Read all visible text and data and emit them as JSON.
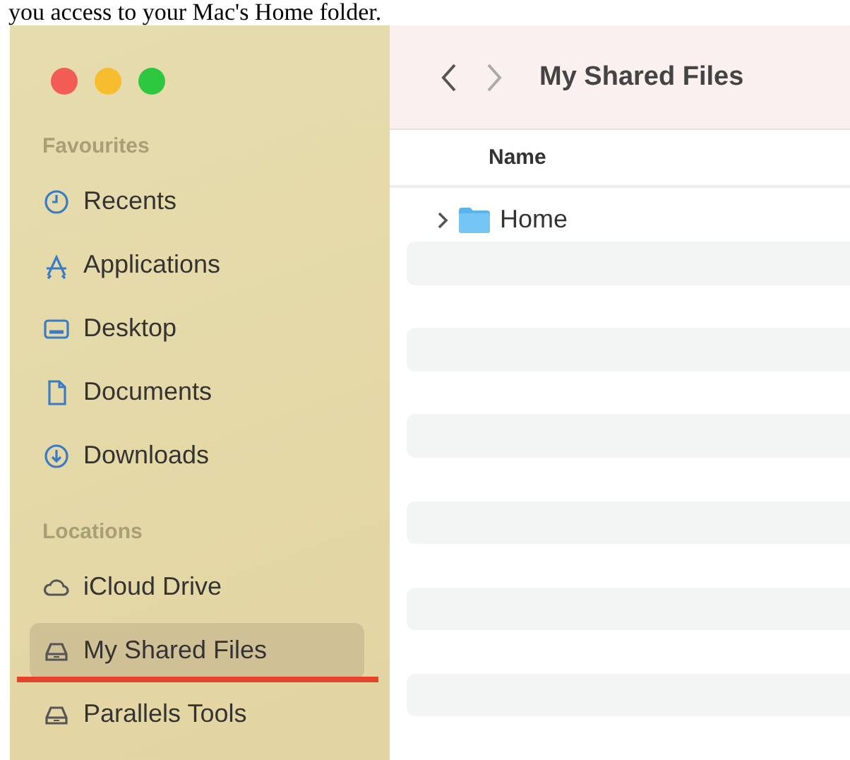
{
  "caption": "you access to your Mac's Home folder.",
  "window": {
    "title": "My Shared Files"
  },
  "sidebar": {
    "sections": [
      {
        "heading": "Favourites",
        "items": [
          {
            "label": "Recents",
            "selected": false,
            "underlined": false
          },
          {
            "label": "Applications",
            "selected": false,
            "underlined": false
          },
          {
            "label": "Desktop",
            "selected": false,
            "underlined": false
          },
          {
            "label": "Documents",
            "selected": false,
            "underlined": false
          },
          {
            "label": "Downloads",
            "selected": false,
            "underlined": false
          }
        ]
      },
      {
        "heading": "Locations",
        "items": [
          {
            "label": "iCloud Drive",
            "selected": false,
            "underlined": false
          },
          {
            "label": "My Shared Files",
            "selected": true,
            "underlined": true
          },
          {
            "label": "Parallels Tools",
            "selected": false,
            "underlined": false
          }
        ]
      }
    ]
  },
  "table": {
    "columns": [
      "Name"
    ],
    "rows": [
      {
        "name": "Home",
        "expanded": false
      }
    ]
  }
}
